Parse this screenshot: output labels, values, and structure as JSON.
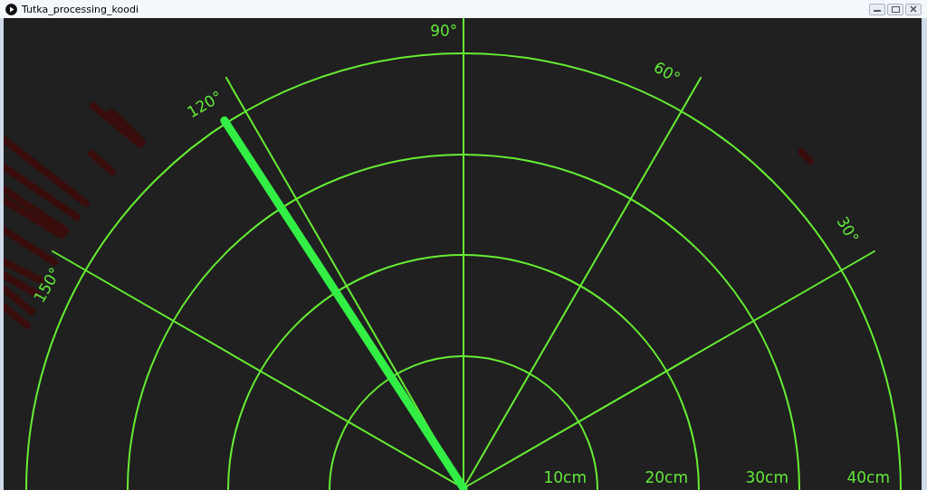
{
  "window": {
    "title": "Tutka_processing_koodi"
  },
  "angle_labels": [
    "30°",
    "60°",
    "90°",
    "120°",
    "150°"
  ],
  "distance_labels": [
    "10cm",
    "20cm",
    "30cm",
    "40cm"
  ]
}
